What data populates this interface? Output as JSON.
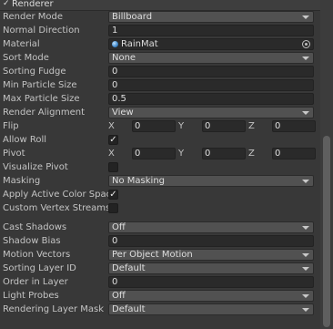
{
  "header": {
    "title": "Renderer",
    "check": "✓"
  },
  "rows": {
    "render_mode": {
      "label": "Render Mode",
      "value": "Billboard"
    },
    "normal_direction": {
      "label": "Normal Direction",
      "value": "1"
    },
    "material": {
      "label": "Material",
      "value": "RainMat"
    },
    "sort_mode": {
      "label": "Sort Mode",
      "value": "None"
    },
    "sorting_fudge": {
      "label": "Sorting Fudge",
      "value": "0"
    },
    "min_particle_size": {
      "label": "Min Particle Size",
      "value": "0"
    },
    "max_particle_size": {
      "label": "Max Particle Size",
      "value": "0.5"
    },
    "render_alignment": {
      "label": "Render Alignment",
      "value": "View"
    },
    "flip": {
      "label": "Flip",
      "x": "0",
      "y": "0",
      "z": "0"
    },
    "allow_roll": {
      "label": "Allow Roll",
      "checked": true,
      "mark": "✓"
    },
    "pivot": {
      "label": "Pivot",
      "x": "0",
      "y": "0",
      "z": "0"
    },
    "visualize_pivot": {
      "label": "Visualize Pivot",
      "checked": false
    },
    "masking": {
      "label": "Masking",
      "value": "No Masking"
    },
    "apply_active_color_space": {
      "label": "Apply Active Color Space",
      "checked": true,
      "mark": "✓"
    },
    "custom_vertex_streams": {
      "label": "Custom Vertex Streams",
      "checked": false
    },
    "cast_shadows": {
      "label": "Cast Shadows",
      "value": "Off"
    },
    "shadow_bias": {
      "label": "Shadow Bias",
      "value": "0"
    },
    "motion_vectors": {
      "label": "Motion Vectors",
      "value": "Per Object Motion"
    },
    "sorting_layer_id": {
      "label": "Sorting Layer ID",
      "value": "Default"
    },
    "order_in_layer": {
      "label": "Order in Layer",
      "value": "0"
    },
    "light_probes": {
      "label": "Light Probes",
      "value": "Off"
    },
    "rendering_layer_mask": {
      "label": "Rendering Layer Mask",
      "value": "Default"
    }
  },
  "axes": {
    "x": "X",
    "y": "Y",
    "z": "Z"
  },
  "icons": {
    "material": "material-sphere-icon",
    "picker": "object-picker-icon",
    "dropdown": "chevron-down-icon"
  }
}
